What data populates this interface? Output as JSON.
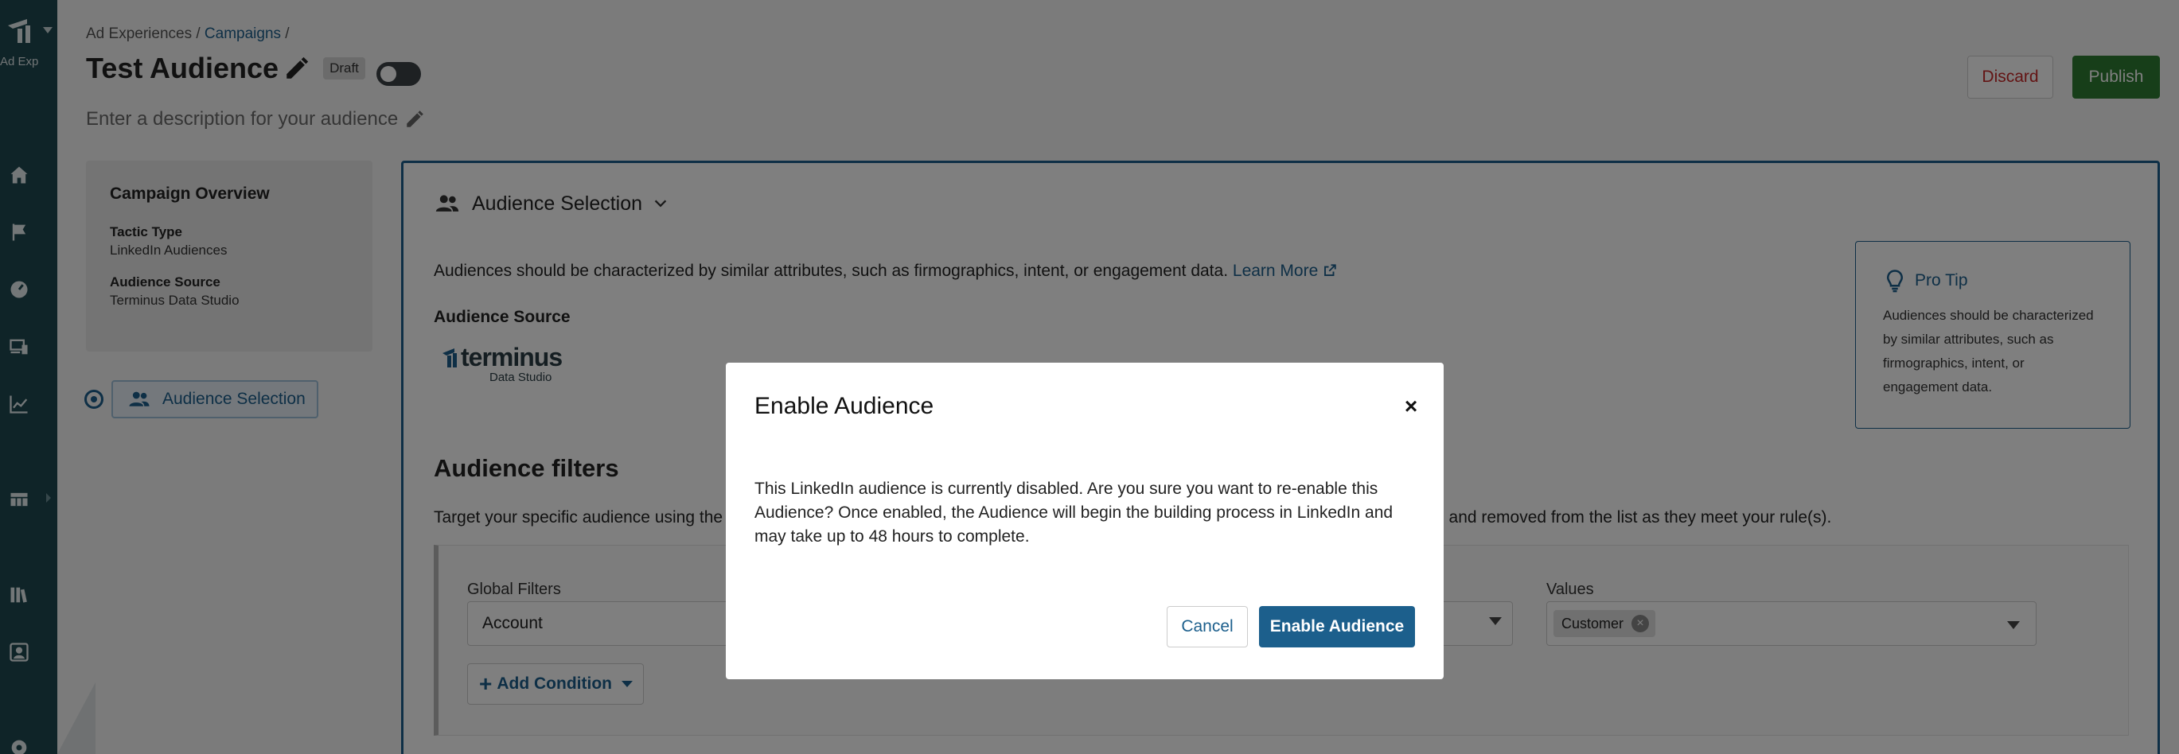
{
  "nav": {
    "app_label": "Ad Experienc...",
    "items": [
      {
        "icon": "home-icon"
      },
      {
        "icon": "flag-icon"
      },
      {
        "icon": "gauge-icon"
      },
      {
        "icon": "devices-icon"
      },
      {
        "icon": "chart-line-icon"
      },
      {
        "icon": "table-icon"
      },
      {
        "icon": "library-icon"
      },
      {
        "icon": "user-badge-icon"
      },
      {
        "icon": "gear-icon"
      }
    ]
  },
  "breadcrumb": {
    "root": "Ad Experiences",
    "sep1": " / ",
    "campaigns": "Campaigns",
    "sep2": " /"
  },
  "header": {
    "title": "Test Audience",
    "status_badge": "Draft",
    "description": "Enter a description for your audience",
    "discard": "Discard",
    "publish": "Publish"
  },
  "overview": {
    "title": "Campaign Overview",
    "tactic_label": "Tactic Type",
    "tactic_value": "LinkedIn Audiences",
    "source_label": "Audience Source",
    "source_value": "Terminus Data Studio"
  },
  "steps": [
    {
      "label": "Audience Selection",
      "active": true
    }
  ],
  "main": {
    "section_title": "Audience Selection",
    "intro": "Audiences should be characterized by similar attributes, such as firmographics, intent, or engagement data.",
    "learn_more": "Learn More",
    "source_label": "Audience Source",
    "logo_word": "terminus",
    "logo_sub": "Data Studio",
    "filters_title": "Audience filters",
    "filters_desc_start": "Target your specific audience using the",
    "filters_desc_end": "d and removed from the list as they meet your rule(s).",
    "global_filters_label": "Global Filters",
    "global_filters_value": "Account",
    "values_label": "Values",
    "value_chip": "Customer",
    "add_condition": "Add Condition"
  },
  "protip": {
    "title": "Pro Tip",
    "body": "Audiences should be characterized by similar attributes, such as firmographics, intent, or engagement data."
  },
  "modal": {
    "title": "Enable Audience",
    "close": "×",
    "body": "This LinkedIn audience is currently disabled. Are you sure you want to re-enable this Audience? Once enabled, the Audience will begin the building process in LinkedIn and may take up to 48 hours to complete.",
    "cancel": "Cancel",
    "confirm": "Enable Audience"
  },
  "colors": {
    "rail": "#1e4851",
    "primary": "#1c5f8c",
    "publish": "#2e7d32",
    "discard": "#c62828"
  }
}
